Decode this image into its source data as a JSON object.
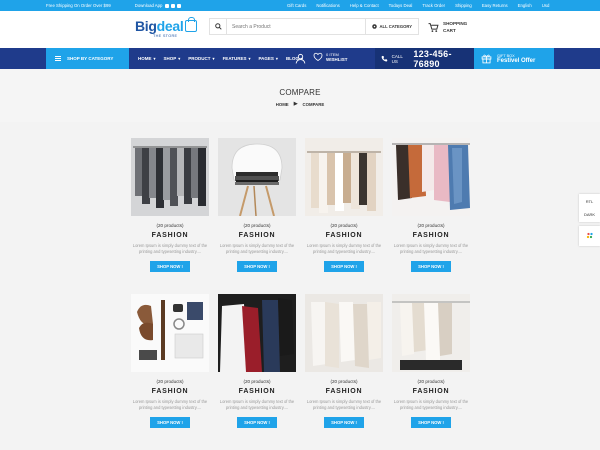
{
  "topbar": {
    "shipping_msg": "Free Shipping On Order Over $99",
    "download_label": "Download App",
    "links": [
      "Gift Cards",
      "Notifications",
      "Help & Contact",
      "Todays Deal",
      "Track Order",
      "Shipping",
      "Easy Returns",
      "English",
      "Usd"
    ]
  },
  "header": {
    "logo_main": "Big",
    "logo_accent": "deal",
    "logo_tagline": "THE STORE",
    "search_placeholder": "Search a Product",
    "category_label": "ALL CATEGORY",
    "cart_line1": "SHOPPING",
    "cart_line2": "CART"
  },
  "nav": {
    "shop_by_category": "SHOP BY CATEGORY",
    "menu": [
      "HOME",
      "SHOP",
      "PRODUCT",
      "FEATURES",
      "PAGES",
      "BLOG"
    ],
    "wishlist_count": "0 ITEM",
    "wishlist_label": "WISHLIST",
    "call_label": "CALL US",
    "phone": "123-456-76890",
    "gift_small": "GIFT BOX",
    "gift_big": "Festivel Offer"
  },
  "banner": {
    "title": "COMPARE",
    "breadcrumb_home": "HOME",
    "breadcrumb_current": "COMPARE"
  },
  "products": [
    {
      "count": "(20 products)",
      "title": "FASHION",
      "desc": "Lorem Ipsum is simply dummy text of the printing and typesetting industry....",
      "button": "SHOP NOW !"
    },
    {
      "count": "(20 products)",
      "title": "FASHION",
      "desc": "Lorem Ipsum is simply dummy text of the printing and typesetting industry....",
      "button": "SHOP NOW !"
    },
    {
      "count": "(20 products)",
      "title": "FASHION",
      "desc": "Lorem Ipsum is simply dummy text of the printing and typesetting industry....",
      "button": "SHOP NOW !"
    },
    {
      "count": "(20 products)",
      "title": "FASHION",
      "desc": "Lorem Ipsum is simply dummy text of the printing and typesetting industry....",
      "button": "SHOP NOW !"
    },
    {
      "count": "(20 products)",
      "title": "FASHION",
      "desc": "Lorem Ipsum is simply dummy text of the printing and typesetting industry....",
      "button": "SHOP NOW !"
    },
    {
      "count": "(20 products)",
      "title": "FASHION",
      "desc": "Lorem Ipsum is simply dummy text of the printing and typesetting industry....",
      "button": "SHOP NOW !"
    },
    {
      "count": "(20 products)",
      "title": "FASHION",
      "desc": "Lorem Ipsum is simply dummy text of the printing and typesetting industry....",
      "button": "SHOP NOW !"
    },
    {
      "count": "(20 products)",
      "title": "FASHION",
      "desc": "Lorem Ipsum is simply dummy text of the printing and typesetting industry....",
      "button": "SHOP NOW !"
    }
  ],
  "side": {
    "rtl": "RTL",
    "dark": "DARK"
  },
  "colors": {
    "accent": "#1fa3e9",
    "nav": "#1f3b8b",
    "brand": "#1f55a3"
  }
}
